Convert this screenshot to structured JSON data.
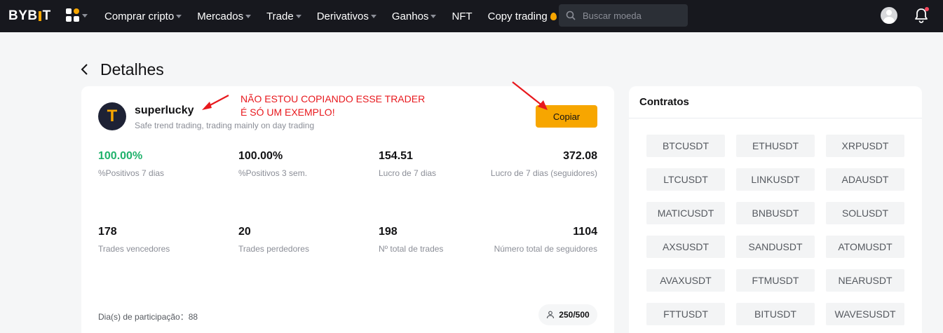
{
  "nav": {
    "logo": "BYBIT",
    "menu": [
      "Comprar cripto",
      "Mercados",
      "Trade",
      "Derivativos",
      "Ganhos",
      "NFT",
      "Copy trading"
    ],
    "search_placeholder": "Buscar moeda",
    "colors": {
      "bg": "#17181e",
      "accent": "#f7a600",
      "notification": "#f6465d"
    }
  },
  "page": {
    "title": "Detalhes"
  },
  "trader": {
    "initial": "T",
    "name": "superlucky",
    "description": "Safe trend trading, trading mainly on day trading",
    "copy_label": "Copiar",
    "stats": [
      {
        "value": "100.00%",
        "label": "%Positivos 7 dias"
      },
      {
        "value": "100.00%",
        "label": "%Positivos 3 sem."
      },
      {
        "value": "154.51",
        "label": "Lucro de 7 dias"
      },
      {
        "value": "372.08",
        "label": "Lucro de 7 dias (seguidores)"
      },
      {
        "value": "178",
        "label": "Trades vencedores"
      },
      {
        "value": "20",
        "label": "Trades perdedores"
      },
      {
        "value": "198",
        "label": "Nº total de trades"
      },
      {
        "value": "1104",
        "label": "Número total de seguidores"
      }
    ],
    "days_label": "Dia(s) de participação：",
    "days_value": "88",
    "seats": "250/500"
  },
  "annotation": {
    "line1": "NÃO ESTOU COPIANDO ESSE TRADER",
    "line2": "É SÓ UM EXEMPLO!"
  },
  "contracts": {
    "title": "Contratos",
    "items": [
      "BTCUSDT",
      "ETHUSDT",
      "XRPUSDT",
      "LTCUSDT",
      "LINKUSDT",
      "ADAUSDT",
      "MATICUSDT",
      "BNBUSDT",
      "SOLUSDT",
      "AXSUSDT",
      "SANDUSDT",
      "ATOMUSDT",
      "AVAXUSDT",
      "FTMUSDT",
      "NEARUSDT",
      "FTTUSDT",
      "BITUSDT",
      "WAVESUSDT"
    ]
  }
}
